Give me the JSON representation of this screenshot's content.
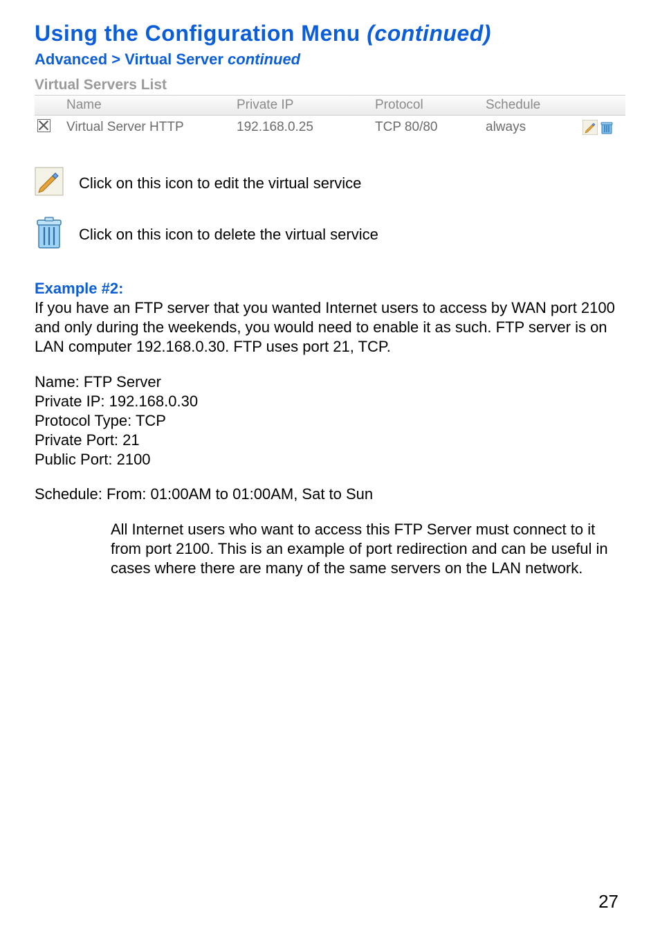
{
  "title": {
    "main": "Using the Configuration Menu ",
    "suffix": "(continued)"
  },
  "breadcrumb": {
    "main": "Advanced > Virtual Server ",
    "suffix": "continued"
  },
  "virtual_servers": {
    "list_title": "Virtual Servers List",
    "headers": {
      "name": "Name",
      "private_ip": "Private IP",
      "protocol": "Protocol",
      "schedule": "Schedule"
    },
    "row": {
      "name": "Virtual Server HTTP",
      "private_ip": "192.168.0.25",
      "protocol": "TCP 80/80",
      "schedule": "always"
    }
  },
  "legend": {
    "edit": "Click on this icon to edit the virtual service",
    "delete": "Click on this icon to delete the virtual service"
  },
  "example": {
    "label": "Example #2:",
    "intro": "If you have an FTP server that you wanted Internet users to access by WAN port 2100 and only during the weekends, you would need to enable it as such. FTP server is on LAN computer 192.168.0.30. FTP uses port 21, TCP.",
    "fields": {
      "name": "Name: FTP Server",
      "private_ip": "Private IP: 192.168.0.30",
      "protocol_type": "Protocol Type: TCP",
      "private_port": "Private Port: 21",
      "public_port": "Public Port: 2100"
    },
    "schedule": "Schedule: From: 01:00AM to 01:00AM, Sat to Sun",
    "note": "All Internet users who want to access this FTP Server must connect to it from port 2100. This is an example of port redirection and can be useful in cases where there are many of the same servers on the LAN network."
  },
  "page_number": "27"
}
